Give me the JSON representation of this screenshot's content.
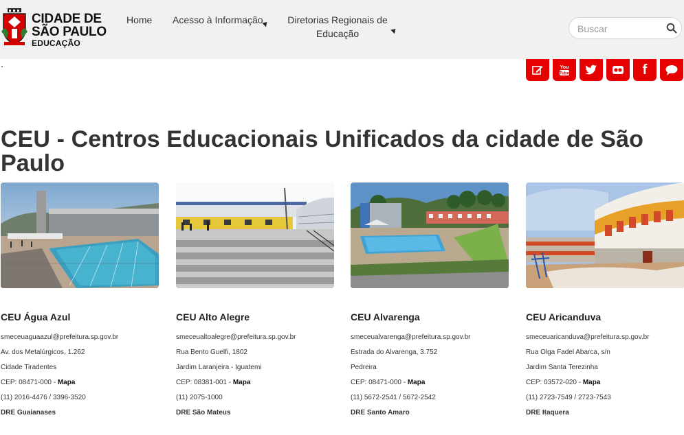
{
  "brand": {
    "line1": "CIDADE DE",
    "line2": "SÃO PAULO",
    "line3": "EDUCAÇÃO"
  },
  "nav": {
    "home": "Home",
    "acesso": "Acesso à Informação",
    "diretorias_l1": "Diretorias Regionais de",
    "diretorias_l2": "Educação"
  },
  "search": {
    "placeholder": "Buscar"
  },
  "social": [
    {
      "icon": "edit-icon"
    },
    {
      "icon": "youtube-icon",
      "label": "You"
    },
    {
      "icon": "twitter-icon"
    },
    {
      "icon": "flickr-icon"
    },
    {
      "icon": "facebook-icon",
      "label": "f"
    },
    {
      "icon": "chat-icon"
    }
  ],
  "page": {
    "title": "CEU - Centros Educacionais Unificados da cidade de São Paulo"
  },
  "cards": [
    {
      "name": "CEU Água Azul",
      "email": "smeceuaguaazul@prefeitura.sp.gov.br",
      "address": "Av. dos Metalúrgicos, 1.262",
      "district": "Cidade Tiradentes",
      "cep": "CEP: 08471-000 - ",
      "map": "Mapa",
      "phone": "(11) 2016-4476 / 3396-3520",
      "dre": "DRE Guaianases"
    },
    {
      "name": "CEU Alto Alegre",
      "email": "smeceualtoalegre@prefeitura.sp.gov.br",
      "address": "Rua Bento Guelfi, 1802",
      "district": "Jardim Laranjeira - Iguatemi",
      "cep": "CEP: 08381-001 - ",
      "map": "Mapa",
      "phone": "(11) 2075-1000",
      "dre": "DRE São Mateus"
    },
    {
      "name": "CEU Alvarenga",
      "email": "smeceualvarenga@prefeitura.sp.gov.br",
      "address": "Estrada do Alvarenga, 3.752",
      "district": "Pedreira",
      "cep": "CEP: 08471-000 - ",
      "map": "Mapa",
      "phone": "(11) 5672-2541 / 5672-2542",
      "dre": "DRE Santo Amaro"
    },
    {
      "name": "CEU Aricanduva",
      "email": "smeceuaricanduva@prefeitura.sp.gov.br",
      "address": "Rua Olga Fadel Abarca, s/n",
      "district": "Jardim Santa Terezinha",
      "cep": "CEP: 03572-020 - ",
      "map": "Mapa",
      "phone": "(11) 2723-7549 / 2723-7543",
      "dre": "DRE Itaquera"
    }
  ],
  "colors": {
    "social_red": "#e60000",
    "header_bg": "#f1f1f1",
    "text": "#333333"
  }
}
